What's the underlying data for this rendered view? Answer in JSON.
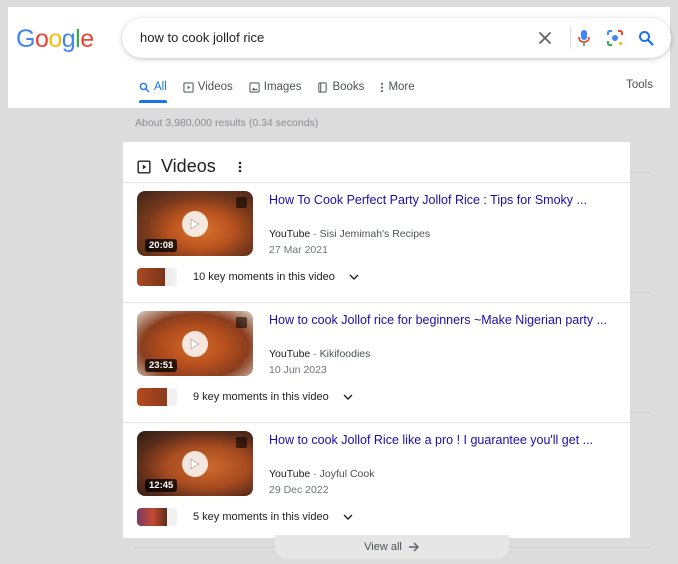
{
  "logo": {
    "text": "Google",
    "letters": [
      "G",
      "o",
      "o",
      "g",
      "l",
      "e"
    ],
    "colors": [
      "#4285F4",
      "#EA4335",
      "#FBBC05",
      "#4285F4",
      "#34A853",
      "#EA4335"
    ]
  },
  "search": {
    "query": "how to cook jollof rice"
  },
  "tabs": [
    {
      "label": "All",
      "icon": "search-icon",
      "active": true
    },
    {
      "label": "Videos",
      "icon": "video-icon",
      "active": false
    },
    {
      "label": "Images",
      "icon": "image-icon",
      "active": false
    },
    {
      "label": "Books",
      "icon": "book-icon",
      "active": false
    },
    {
      "label": "More",
      "icon": "more-vertical-icon",
      "active": false
    }
  ],
  "tools_label": "Tools",
  "stats": "About 3,980,000 results (0.34 seconds)",
  "videos_section": {
    "title": "Videos",
    "items": [
      {
        "title": "How To Cook Perfect Party Jollof Rice : Tips for Smoky ...",
        "source": "YouTube",
        "channel": "Sisi Jemimah's Recipes",
        "date": "27 Mar 2021",
        "duration": "20:08",
        "key_moments": "10 key moments in this video"
      },
      {
        "title": "How to cook Jollof rice for beginners ~Make Nigerian party ...",
        "source": "YouTube",
        "channel": "Kikifoodies",
        "date": "10 Jun 2023",
        "duration": "23:51",
        "key_moments": "9 key moments in this video"
      },
      {
        "title": "How to cook Jollof Rice like a pro ! I guarantee you'll get ...",
        "source": "YouTube",
        "channel": "Joyful Cook",
        "date": "29 Dec 2022",
        "duration": "12:45",
        "key_moments": "5 key moments in this video"
      }
    ],
    "view_all": "View all"
  }
}
